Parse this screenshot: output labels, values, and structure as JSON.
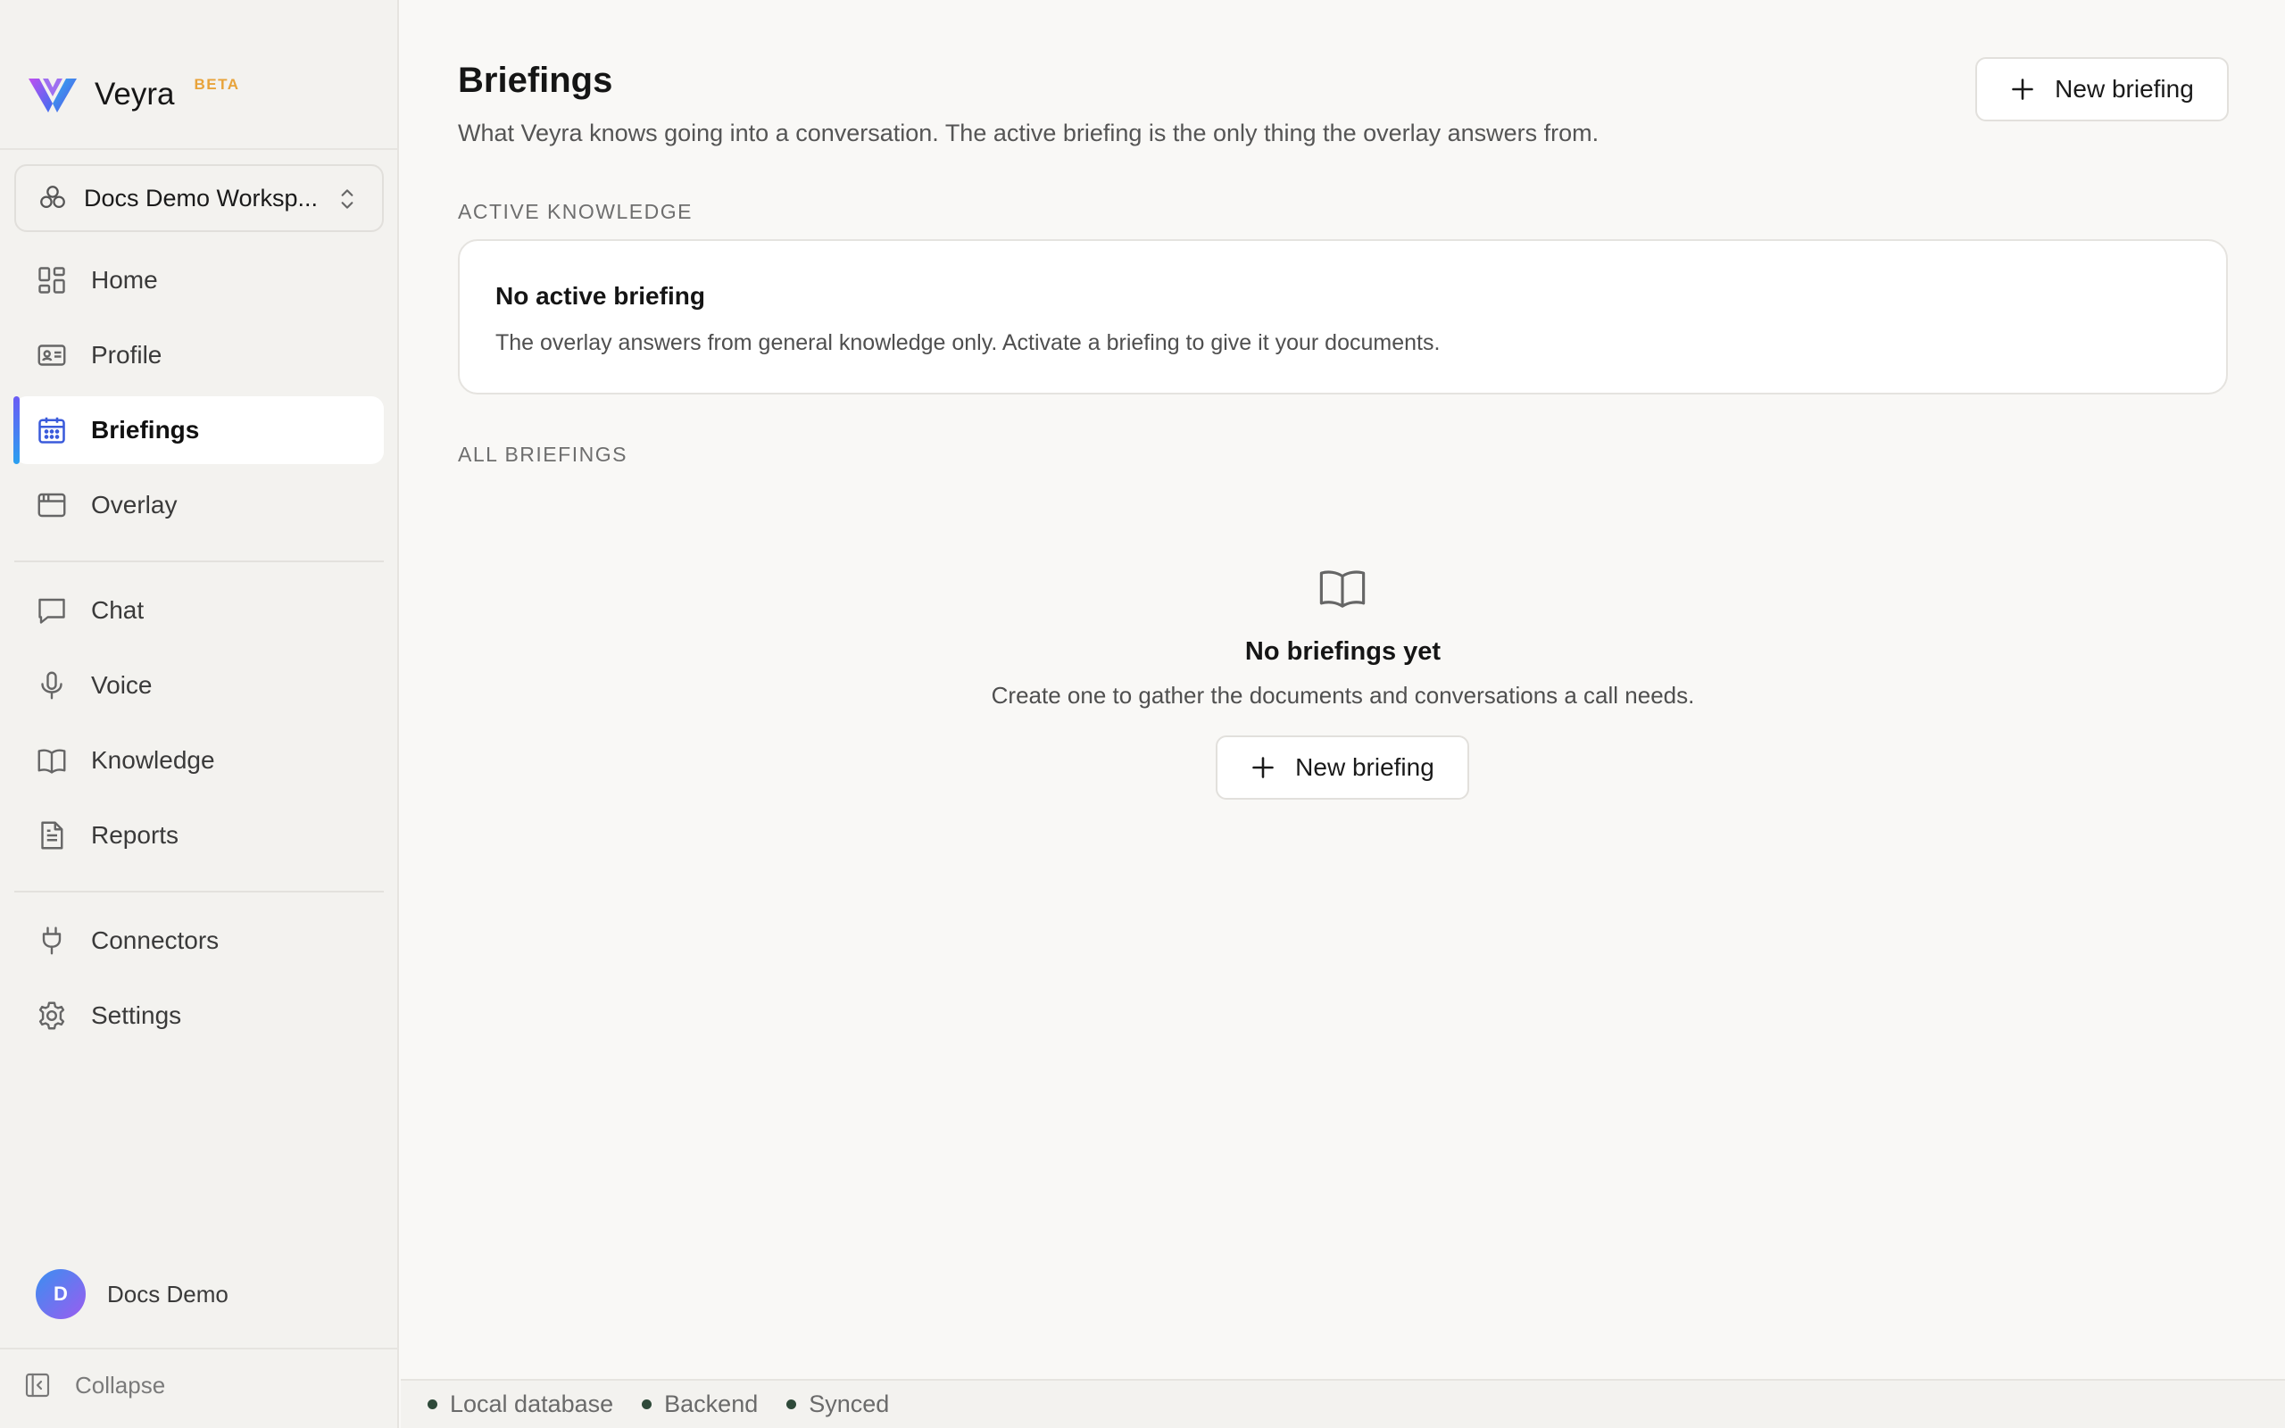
{
  "brand": {
    "name": "Veyra",
    "badge": "BETA"
  },
  "workspace": {
    "label": "Docs Demo Worksp..."
  },
  "nav": {
    "primary": [
      {
        "label": "Home",
        "icon": "grid-icon"
      },
      {
        "label": "Profile",
        "icon": "id-card-icon"
      },
      {
        "label": "Briefings",
        "icon": "calendar-icon",
        "active": true
      },
      {
        "label": "Overlay",
        "icon": "window-icon"
      }
    ],
    "secondary": [
      {
        "label": "Chat",
        "icon": "chat-bubble-icon"
      },
      {
        "label": "Voice",
        "icon": "microphone-icon"
      },
      {
        "label": "Knowledge",
        "icon": "book-icon"
      },
      {
        "label": "Reports",
        "icon": "document-icon"
      }
    ],
    "tertiary": [
      {
        "label": "Connectors",
        "icon": "plug-icon"
      },
      {
        "label": "Settings",
        "icon": "gear-icon"
      }
    ]
  },
  "user": {
    "initial": "D",
    "name": "Docs Demo"
  },
  "collapse": {
    "label": "Collapse"
  },
  "page": {
    "title": "Briefings",
    "subtitle": "What Veyra knows going into a conversation. The active briefing is the only thing the overlay answers from.",
    "new_button": "New briefing"
  },
  "active_knowledge": {
    "section_label": "ACTIVE KNOWLEDGE",
    "title": "No active briefing",
    "text": "The overlay answers from general knowledge only. Activate a briefing to give it your documents."
  },
  "all_briefings": {
    "section_label": "ALL BRIEFINGS",
    "empty_title": "No briefings yet",
    "empty_text": "Create one to gather the documents and conversations a call needs.",
    "empty_button": "New briefing"
  },
  "status": [
    {
      "label": "Local database"
    },
    {
      "label": "Backend"
    },
    {
      "label": "Synced"
    }
  ],
  "colors": {
    "accent_beta": "#e8a33a",
    "active_icon": "#3b5bdb",
    "status_dot": "#2f4a3a"
  }
}
